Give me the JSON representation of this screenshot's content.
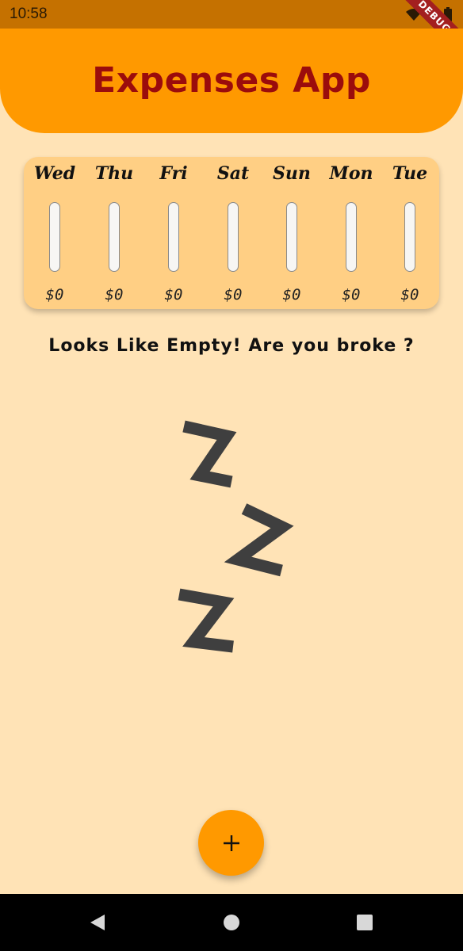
{
  "status_bar": {
    "time": "10:58",
    "icons": [
      "wifi-icon",
      "signal-icon",
      "battery-icon"
    ]
  },
  "debug_banner": "DEBUG",
  "app_bar": {
    "title": "Expenses App",
    "background": "#ff9900",
    "title_color": "#9b0c0c"
  },
  "chart": {
    "days": [
      {
        "label": "Wed",
        "amount": "$0",
        "fill_fraction": 0
      },
      {
        "label": "Thu",
        "amount": "$0",
        "fill_fraction": 0
      },
      {
        "label": "Fri",
        "amount": "$0",
        "fill_fraction": 0
      },
      {
        "label": "Sat",
        "amount": "$0",
        "fill_fraction": 0
      },
      {
        "label": "Sun",
        "amount": "$0",
        "fill_fraction": 0
      },
      {
        "label": "Mon",
        "amount": "$0",
        "fill_fraction": 0
      },
      {
        "label": "Tue",
        "amount": "$0",
        "fill_fraction": 0
      }
    ]
  },
  "empty_state": {
    "message": "Looks Like Empty! Are you broke ?",
    "image_icon": "zzz-sleep-icon"
  },
  "fab": {
    "icon": "plus-icon",
    "label": "+"
  },
  "nav_bar": {
    "buttons": [
      "back-icon",
      "home-icon",
      "recents-icon"
    ]
  }
}
